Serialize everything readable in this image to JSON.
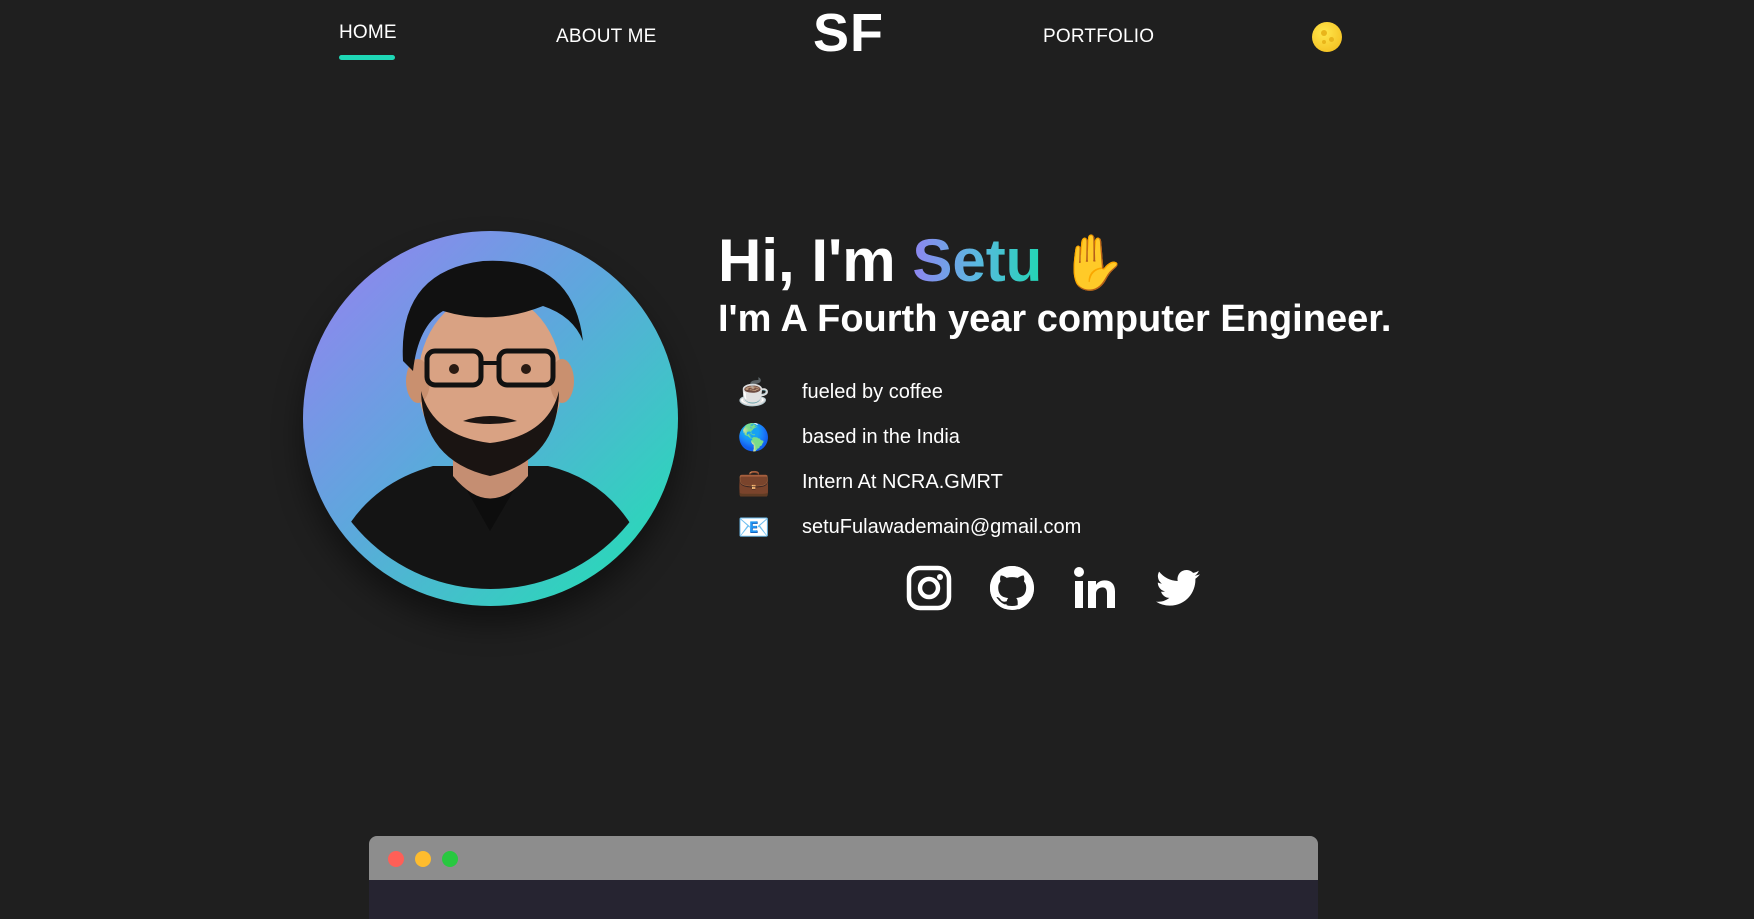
{
  "nav": {
    "home": "HOME",
    "about": "ABOUT ME",
    "logo": "SF",
    "portfolio": "PORTFOLIO",
    "theme_toggle_icon": "moon-icon"
  },
  "intro": {
    "greeting_prefix": "Hi, I'm",
    "name": "Setu",
    "wave_emoji": "✋",
    "subtitle": "I'm A Fourth year computer Engineer."
  },
  "facts": [
    {
      "icon": "coffee-icon",
      "emoji": "☕",
      "text": "fueled by coffee"
    },
    {
      "icon": "globe-icon",
      "emoji": "🌎",
      "text": "based in the India"
    },
    {
      "icon": "briefcase-icon",
      "emoji": "💼",
      "text": "Intern At NCRA.GMRT"
    },
    {
      "icon": "email-icon",
      "emoji": "📧",
      "text": "setuFulawademain@gmail.com"
    }
  ],
  "socials": [
    "instagram-icon",
    "github-icon",
    "linkedin-icon",
    "twitter-icon"
  ],
  "colors": {
    "background": "#1f1f1f",
    "accent": "#1ed7b5",
    "name_gradient": [
      "#8f85f0",
      "#22d6b4"
    ],
    "terminal_bar": "#8d8d8d",
    "terminal_body": "#262431"
  }
}
